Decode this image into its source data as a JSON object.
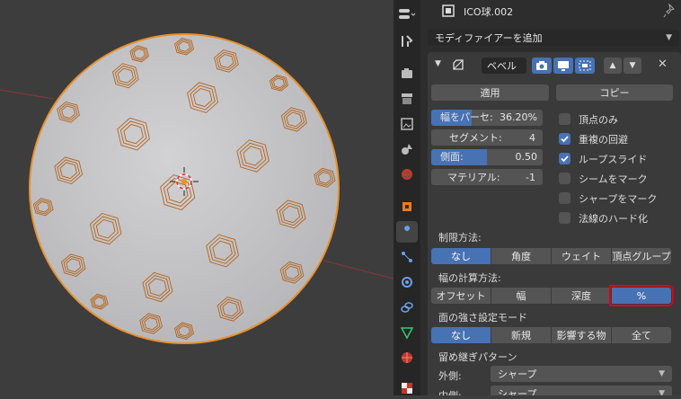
{
  "header": {
    "object_name": "ICO球.002"
  },
  "modifier_add_label": "モディファイアーを追加",
  "modifier": {
    "name": "ベベル",
    "apply_label": "適用",
    "copy_label": "コピー"
  },
  "bevel": {
    "width": {
      "label": "幅をパーセ:",
      "value": "36.20%",
      "fraction": 0.362
    },
    "segments": {
      "label": "セグメント:",
      "value": "4"
    },
    "profile": {
      "label": "側面:",
      "value": "0.50",
      "fraction": 0.5
    },
    "material": {
      "label": "マテリアル:",
      "value": "-1"
    }
  },
  "checks": [
    {
      "label": "頂点のみ",
      "checked": false
    },
    {
      "label": "重複の回避",
      "checked": true
    },
    {
      "label": "ループスライド",
      "checked": true
    },
    {
      "label": "シームをマーク",
      "checked": false
    },
    {
      "label": "シャープをマーク",
      "checked": false
    },
    {
      "label": "法線のハード化",
      "checked": false
    }
  ],
  "limit_method": {
    "label": "制限方法:",
    "options": [
      "なし",
      "角度",
      "ウェイト",
      "頂点グループ"
    ],
    "selected": "なし"
  },
  "width_method": {
    "label": "幅の計算方法:",
    "options": [
      "オフセット",
      "幅",
      "深度",
      "%"
    ],
    "selected": "%"
  },
  "face_strength": {
    "label": "面の強さ設定モード",
    "options": [
      "なし",
      "新規",
      "影響する物",
      "全て"
    ],
    "selected": "なし"
  },
  "miter": {
    "label": "留め継ぎパターン",
    "outer": {
      "label": "外側:",
      "value": "シャープ"
    },
    "inner": {
      "label": "内側:",
      "value": "シャープ"
    }
  },
  "colors": {
    "accent": "#4772b3",
    "wire": "#e8912d",
    "highlight": "#e0001a"
  }
}
